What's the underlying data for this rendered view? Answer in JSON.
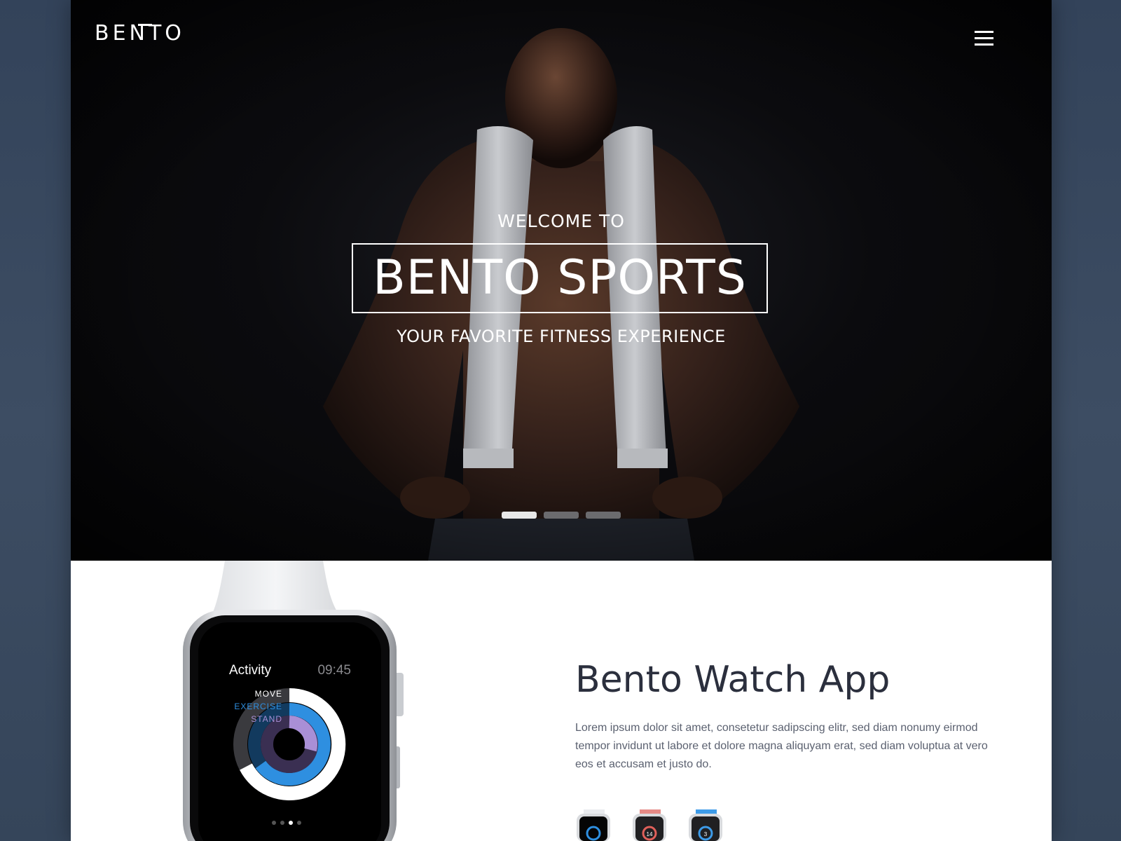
{
  "brand": {
    "logo_text": "BENTŌ",
    "logo_letters": "BENTO"
  },
  "header": {
    "menu_icon": "hamburger-menu-icon"
  },
  "hero": {
    "welcome": "WELCOME TO",
    "title": "BENTO SPORTS",
    "tagline": "YOUR FAVORITE FITNESS EXPERIENCE",
    "slides": [
      {
        "active": true
      },
      {
        "active": false
      },
      {
        "active": false
      }
    ]
  },
  "feature": {
    "title": "Bento Watch App",
    "description": "Lorem ipsum dolor sit amet, consetetur sadipscing elitr, sed diam nonumy eirmod tempor invidunt ut labore et dolore magna aliquyam erat, sed diam voluptua at vero eos et accusam et justo do.",
    "watch_screen": {
      "app_name": "Activity",
      "time": "09:45",
      "rings": [
        {
          "label": "MOVE",
          "color": "#ffffff"
        },
        {
          "label": "EXERCISE",
          "color": "#2e8fe0"
        },
        {
          "label": "STAND",
          "color": "#a98fd6"
        }
      ],
      "page_dots": 4,
      "active_page_dot": 3
    },
    "thumbnails": [
      {
        "band_color": "#e9ebee",
        "screen_value": ""
      },
      {
        "band_color": "#e58a86",
        "screen_value": "14"
      },
      {
        "band_color": "#3d9be8",
        "screen_value": "3"
      }
    ]
  },
  "colors": {
    "hero_bg": "#07070a",
    "heading": "#2b2f3d",
    "body_text": "#5b6170",
    "frame_bg": "#3a4a5e",
    "dot_active": "#e8e8e8",
    "dot_inactive": "#6b6b6e"
  }
}
